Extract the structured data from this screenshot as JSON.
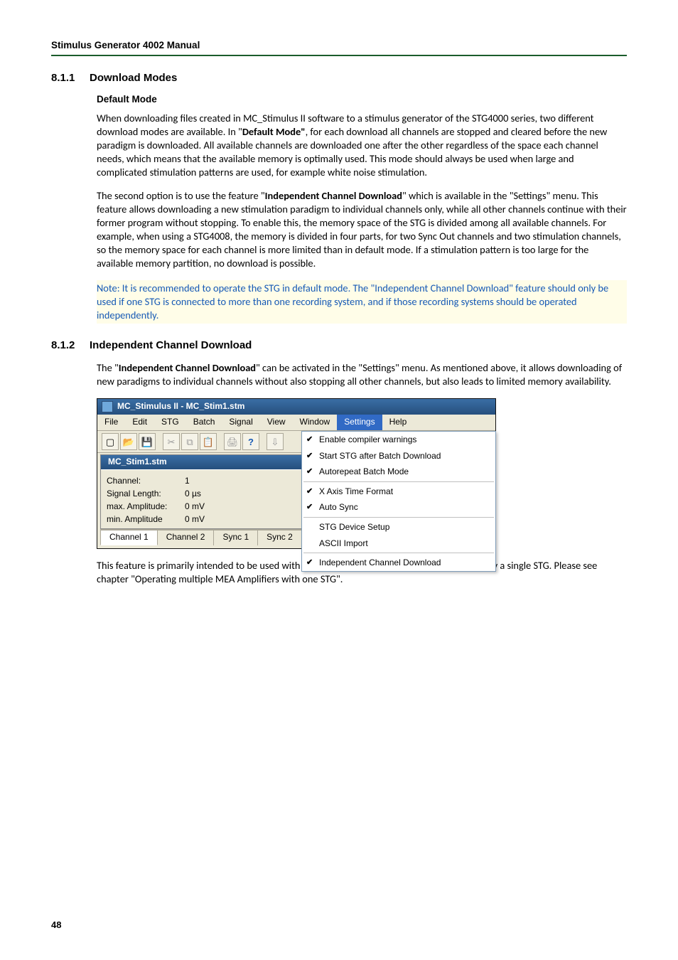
{
  "runningHeader": "Stimulus Generator 4002 Manual",
  "s811": {
    "num": "8.1.1",
    "title": "Download Modes",
    "subheading": "Default Mode",
    "p1_a": "When downloading files created in MC_Stimulus II software to a stimulus generator of the STG4000 series, two different download modes are available. In \"",
    "p1_b": "Default Mode\"",
    "p1_c": ", for each download all channels are stopped and cleared before the new paradigm is downloaded. All available channels are downloaded one after the other regardless of the space each channel needs, which means that the available memory is optimally used. This mode should always be used when large and complicated stimulation patterns are used, for example white noise stimulation.",
    "p2_a": "The second option is to use the feature \"",
    "p2_b": "Independent Channel Download",
    "p2_c": "\" which is available in the \"Settings\" menu. This feature allows downloading a new stimulation paradigm to individual channels only, while all other channels continue with their former program without stopping. To enable this, the memory space of the STG is divided among all available channels. For example, when using a STG4008, the memory is divided in four parts, for two Sync Out channels and two stimulation channels, so the memory space for each channel is more limited than in default mode. If a stimulation pattern is too large for the available memory partition, no download is possible.",
    "note": "Note: It is recommended to operate the STG in default mode. The \"Independent Channel Download\" feature should only be used if one STG is connected to more than one recording system, and if those recording systems should be operated independently."
  },
  "s812": {
    "num": "8.1.2",
    "title": "Independent Channel Download",
    "p1_a": "The \"",
    "p1_b": "Independent Channel Download",
    "p1_c": "\" can be activated in the \"Settings\" menu. As mentioned above, it allows downloading of new paradigms to individual channels without also stopping all other channels, but also leads to limited memory availability.",
    "p_after": "This feature is primarily intended to be used with MEA-Systems with multiple amplifiers and only a single STG. Please see chapter \"Operating multiple MEA Amplifiers with one STG\"."
  },
  "screenshot": {
    "appTitle": "MC_Stimulus II - MC_Stim1.stm",
    "menus": [
      "File",
      "Edit",
      "STG",
      "Batch",
      "Signal",
      "View",
      "Window",
      "Settings",
      "Help"
    ],
    "selectedMenuIndex": 7,
    "toolbarIcons": [
      "new",
      "open",
      "save",
      "sep",
      "cut",
      "copy",
      "paste",
      "sep",
      "print",
      "help",
      "sep",
      "download"
    ],
    "childTitle": "MC_Stim1.stm",
    "childRows": [
      {
        "label": "Channel:",
        "value": "1"
      },
      {
        "label": "Signal Length:",
        "value": "0 µs"
      },
      {
        "label": "max. Amplitude:",
        "value": "0 mV"
      },
      {
        "label": "min. Amplitude",
        "value": "0 mV"
      }
    ],
    "tabs": [
      "Channel 1",
      "Channel 2",
      "Sync 1",
      "Sync 2"
    ],
    "activeTab": 0,
    "dropdown": [
      {
        "label": "Enable compiler warnings",
        "checked": true
      },
      {
        "label": "Start STG after Batch Download",
        "checked": true
      },
      {
        "label": "Autorepeat Batch Mode",
        "checked": true
      },
      {
        "sep": true
      },
      {
        "label": "X Axis Time Format",
        "checked": true
      },
      {
        "label": "Auto Sync",
        "checked": true
      },
      {
        "sep": true
      },
      {
        "label": "STG Device Setup",
        "checked": false
      },
      {
        "label": "ASCII Import",
        "checked": false
      },
      {
        "sep": true
      },
      {
        "label": "Independent Channel Download",
        "checked": true
      }
    ]
  },
  "pageNumber": "48"
}
